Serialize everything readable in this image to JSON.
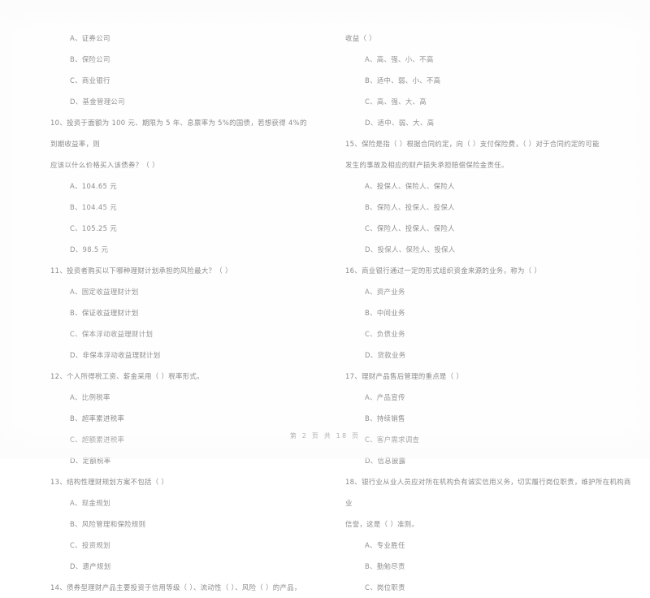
{
  "document": {
    "type": "scanned-exam-paper",
    "language": "zh-CN",
    "footer": "第 2 页  共 18 页",
    "text_color": "#8e8e8e",
    "page_color": "#fefefe"
  },
  "left_column": {
    "orphan_options": [
      "A、证券公司",
      "B、保险公司",
      "C、商业银行",
      "D、基金管理公司"
    ],
    "questions": [
      {
        "number": "10",
        "stem": "10、投资于面额为 100 元、期限为 5 年、息票率为 5%的国债，若想获得 4%的到期收益率，则",
        "stem_cont": "应该以什么价格买入该债券？（      ）",
        "options": [
          "A、104.65 元",
          "B、104.45 元",
          "C、105.25 元",
          "D、98.5 元"
        ]
      },
      {
        "number": "11",
        "stem": "11、投资者购买以下哪种理财计划承担的风险最大？（      ）",
        "stem_cont": "",
        "options": [
          "A、固定收益理财计划",
          "B、保证收益理财计划",
          "C、保本浮动收益理财计划",
          "D、非保本浮动收益理财计划"
        ]
      },
      {
        "number": "12",
        "stem": "12、个人所得税工资、薪金采用（      ）税率形式。",
        "stem_cont": "",
        "options": [
          "A、比例税率",
          "B、超率累进税率",
          "C、超额累进税率",
          "D、定额税率"
        ]
      },
      {
        "number": "13",
        "stem": "13、结构性理财规划方案不包括（      ）",
        "stem_cont": "",
        "options": [
          "A、现金规划",
          "B、风险管理和保险规则",
          "C、投资规划",
          "D、遗产规划"
        ]
      },
      {
        "number": "14",
        "stem": "14、债券型理财产品主要投资于信用等级（      ）、流动性（      ）、风险（      ）的产品，",
        "stem_cont": "",
        "options": []
      }
    ]
  },
  "right_column": {
    "orphan_stem": "收益（      ）",
    "orphan_options": [
      "A、高、强、小、不高",
      "B、适中、弱、小、不高",
      "C、高、强、大、高",
      "D、适中、弱、大、高"
    ],
    "questions": [
      {
        "number": "15",
        "stem": "15、保险是指（      ）根据合同约定，向（      ）支付保险费，（      ）对于合同约定的可能",
        "stem_cont": "发生的事故及相应的财产损失承担赔偿保险金责任。",
        "options": [
          "A、投保人、保险人、保险人",
          "B、保险人、投保人、投保人",
          "C、保险人、投保人、保险人",
          "D、投保人、保险人、投保人"
        ]
      },
      {
        "number": "16",
        "stem": "16、商业银行通过一定的形式组织资金来源的业务，称为（      ）",
        "stem_cont": "",
        "options": [
          "A、资产业务",
          "B、中间业务",
          "C、负债业务",
          "D、贷款业务"
        ]
      },
      {
        "number": "17",
        "stem": "17、理财产品售后管理的重点是（      ）",
        "stem_cont": "",
        "options": [
          "A、产品宣传",
          "B、持续销售",
          "C、客户需求调查",
          "D、信息披露"
        ]
      },
      {
        "number": "18",
        "stem": "18、银行业从业人员应对所在机构负有诚实信用义务，切实履行岗位职责，维护所在机构商业",
        "stem_cont": "信誉，这是（      ）准则。",
        "options": [
          "A、专业胜任",
          "B、勤勉尽责",
          "C、岗位职责"
        ]
      }
    ]
  }
}
